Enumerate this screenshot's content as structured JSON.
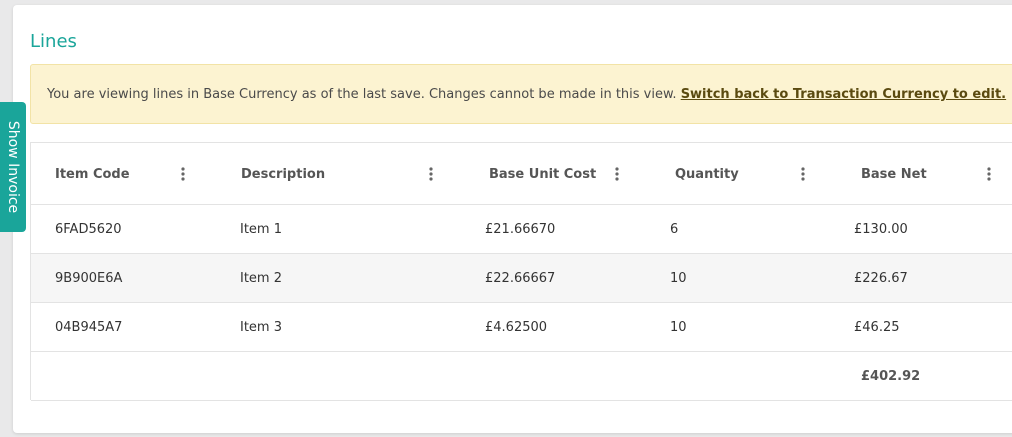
{
  "section": {
    "title": "Lines"
  },
  "notice": {
    "text": "You are viewing lines in Base Currency as of the last save. Changes cannot be made in this view. ",
    "link": "Switch back to Transaction Currency to edit."
  },
  "side_tab": {
    "label": "Show Invoice"
  },
  "table": {
    "columns": [
      "Item Code",
      "Description",
      "Base Unit Cost",
      "Quantity",
      "Base Net"
    ],
    "rows": [
      [
        "6FAD5620",
        "Item 1",
        "£21.66670",
        "6",
        "£130.00"
      ],
      [
        "9B900E6A",
        "Item 2",
        "£22.66667",
        "10",
        "£226.67"
      ],
      [
        "04B945A7",
        "Item 3",
        "£4.62500",
        "10",
        "£46.25"
      ]
    ],
    "total": "£402.92"
  },
  "colors": {
    "accent": "#1aa59a",
    "notice_bg": "#fcf3d1"
  },
  "icons": {
    "column_menu": "kebab-menu-icon"
  }
}
